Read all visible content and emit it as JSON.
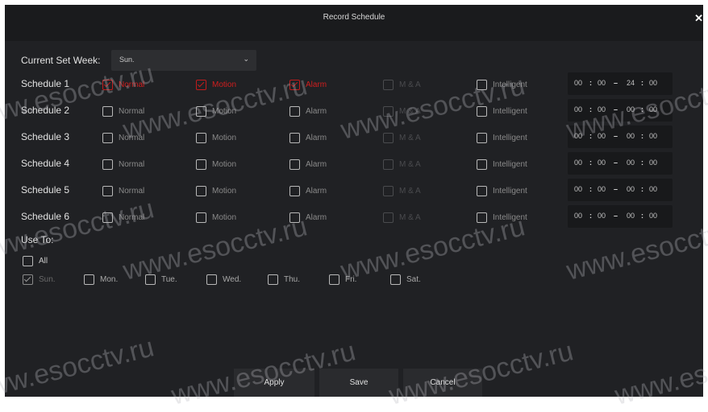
{
  "dialog": {
    "title": "Record Schedule",
    "close_label": "✕"
  },
  "current_set_week": {
    "label": "Current Set Week:",
    "value": "Sun."
  },
  "schedule_columns": [
    "Normal",
    "Motion",
    "Alarm",
    "M & A",
    "Intelligent"
  ],
  "schedules": [
    {
      "name": "Schedule 1",
      "checked": [
        true,
        true,
        true,
        false,
        false
      ],
      "start_h": "00",
      "start_m": "00",
      "end_h": "24",
      "end_m": "00"
    },
    {
      "name": "Schedule 2",
      "checked": [
        false,
        false,
        false,
        false,
        false
      ],
      "start_h": "00",
      "start_m": "00",
      "end_h": "00",
      "end_m": "00"
    },
    {
      "name": "Schedule 3",
      "checked": [
        false,
        false,
        false,
        false,
        false
      ],
      "start_h": "00",
      "start_m": "00",
      "end_h": "00",
      "end_m": "00"
    },
    {
      "name": "Schedule 4",
      "checked": [
        false,
        false,
        false,
        false,
        false
      ],
      "start_h": "00",
      "start_m": "00",
      "end_h": "00",
      "end_m": "00"
    },
    {
      "name": "Schedule 5",
      "checked": [
        false,
        false,
        false,
        false,
        false
      ],
      "start_h": "00",
      "start_m": "00",
      "end_h": "00",
      "end_m": "00"
    },
    {
      "name": "Schedule 6",
      "checked": [
        false,
        false,
        false,
        false,
        false
      ],
      "start_h": "00",
      "start_m": "00",
      "end_h": "00",
      "end_m": "00"
    }
  ],
  "time_separator": ":",
  "time_dash": "–",
  "use_to": {
    "label": "Use To:",
    "all_label": "All",
    "days": [
      {
        "label": "Sun.",
        "checked": true
      },
      {
        "label": "Mon.",
        "checked": false
      },
      {
        "label": "Tue.",
        "checked": false
      },
      {
        "label": "Wed.",
        "checked": false
      },
      {
        "label": "Thu.",
        "checked": false
      },
      {
        "label": "Fri.",
        "checked": false
      },
      {
        "label": "Sat.",
        "checked": false
      }
    ]
  },
  "buttons": {
    "apply": "Apply",
    "save": "Save",
    "cancel": "Cancel"
  },
  "watermark": "www.esocctv.ru",
  "colors": {
    "accent": "#d11e1e",
    "background": "#202124",
    "titlebar": "#1a1b1d"
  }
}
